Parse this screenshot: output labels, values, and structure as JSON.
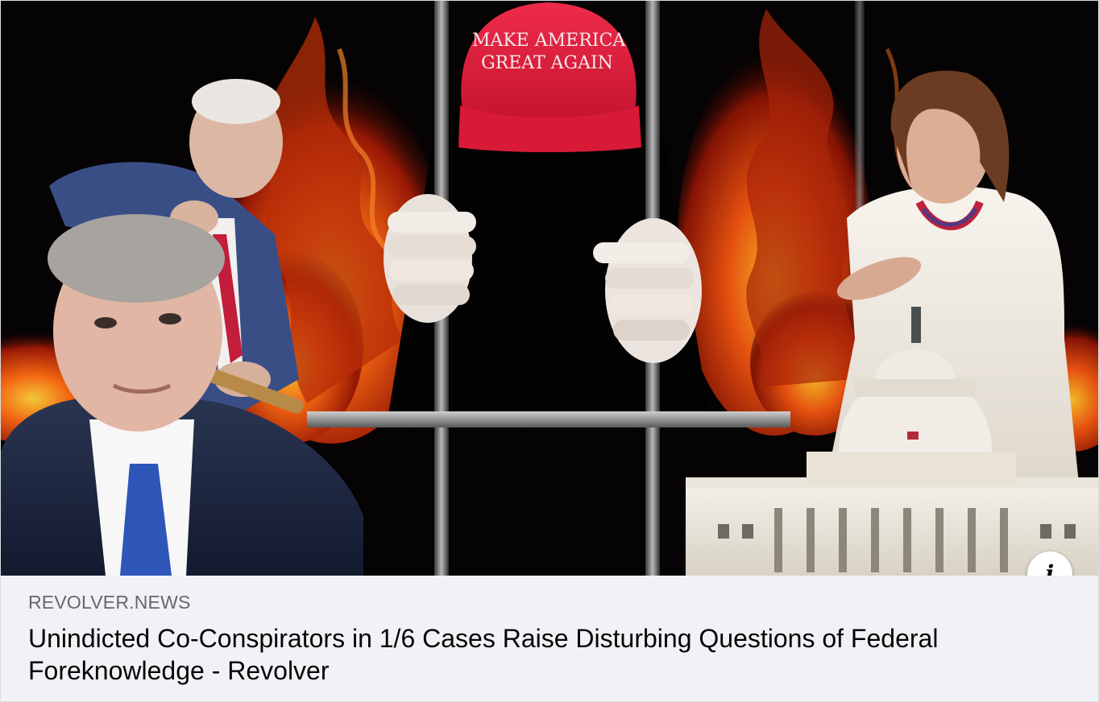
{
  "link_card": {
    "image": {
      "alt_description": "",
      "hat_text_line1": "MAKE AMERICA",
      "hat_text_line2": "GREAT AGAIN"
    },
    "info_button_icon": "info-icon",
    "domain": "REVOLVER.NEWS",
    "headline": "Unindicted Co-Conspirators in 1/6 Cases Raise Disturbing Questions of Federal Foreknowledge - Revolver"
  },
  "colors": {
    "card_background": "#f0f2f5",
    "domain_text": "#65676b",
    "headline_text": "#050505",
    "hat_red": "#e0213f",
    "flame_orange": "#ff6a12"
  }
}
